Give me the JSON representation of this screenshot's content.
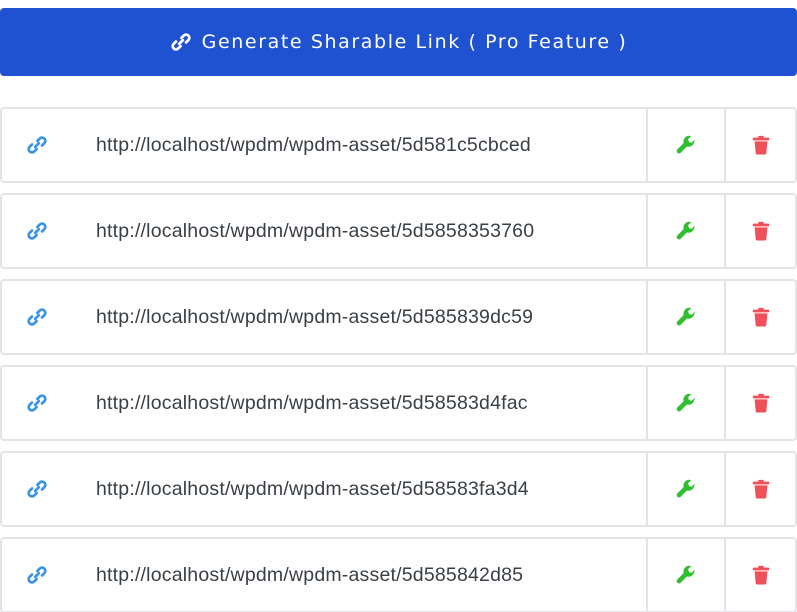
{
  "generate_button": {
    "label": "Generate Sharable Link ( Pro Feature )",
    "icon": "link-icon",
    "color": "#1f52d0"
  },
  "colors": {
    "link_icon": "#3b93e8",
    "wrench_icon": "#2fbf2f",
    "trash_icon": "#f0505a",
    "border": "#e2e4e7",
    "url_text": "#3a3f44"
  },
  "links": [
    {
      "url": "http://localhost/wpdm/wpdm-asset/5d581c5cbced"
    },
    {
      "url": "http://localhost/wpdm/wpdm-asset/5d5858353760"
    },
    {
      "url": "http://localhost/wpdm/wpdm-asset/5d585839dc59"
    },
    {
      "url": "http://localhost/wpdm/wpdm-asset/5d58583d4fac"
    },
    {
      "url": "http://localhost/wpdm/wpdm-asset/5d58583fa3d4"
    },
    {
      "url": "http://localhost/wpdm/wpdm-asset/5d585842d85"
    }
  ]
}
